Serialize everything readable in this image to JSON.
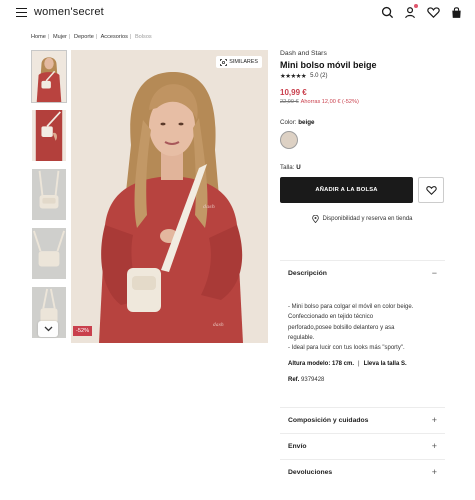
{
  "header": {
    "logo": "women'secret",
    "icons": [
      "menu-icon",
      "search-icon",
      "account-icon",
      "heart-icon",
      "bag-icon"
    ],
    "notification_color": "#e0566d"
  },
  "breadcrumb": {
    "items": [
      "Home",
      "Mujer",
      "Deporte",
      "Accesorios",
      "Bolsos"
    ]
  },
  "gallery": {
    "similares_label": "SIMILARES",
    "discount_badge": "-52%",
    "thumbnail_count": 6
  },
  "product": {
    "brand": "Dash and Stars",
    "name": "Mini bolso móvil beige",
    "stars": "★★★★★",
    "rating": "5.0 (2)",
    "price": "10,99 €",
    "old_price": "22,99 €",
    "saving": "Ahorras 12,00 € (-52%)",
    "color_label": "Color:",
    "color_value": "beige",
    "swatch_color": "#ddd1c4",
    "size_label": "Talla:",
    "size_value": "U",
    "add_to_bag": "AÑADIR A LA BOLSA",
    "store_link": "Disponibilidad y reserva en tienda",
    "accent_color": "#c9404d"
  },
  "accordion": {
    "description": {
      "title": "Descripción",
      "sign": "−",
      "lines": [
        "- Mini bolso para colgar el móvil en color beige.",
        "Confeccionado en tejido técnico",
        "perforado,posee bolsillo delantero y asa",
        "regulable.",
        "- Ideal para lucir con tus looks más \"sporty\"."
      ],
      "model_height": "Altura modelo: 178 cm.",
      "model_size": "Lleva la talla S.",
      "ref_label": "Ref.",
      "ref_value": "9379428"
    },
    "composition": {
      "title": "Composición y cuidados",
      "sign": "+"
    },
    "shipping": {
      "title": "Envío",
      "sign": "+"
    },
    "returns": {
      "title": "Devoluciones",
      "sign": "+"
    }
  }
}
